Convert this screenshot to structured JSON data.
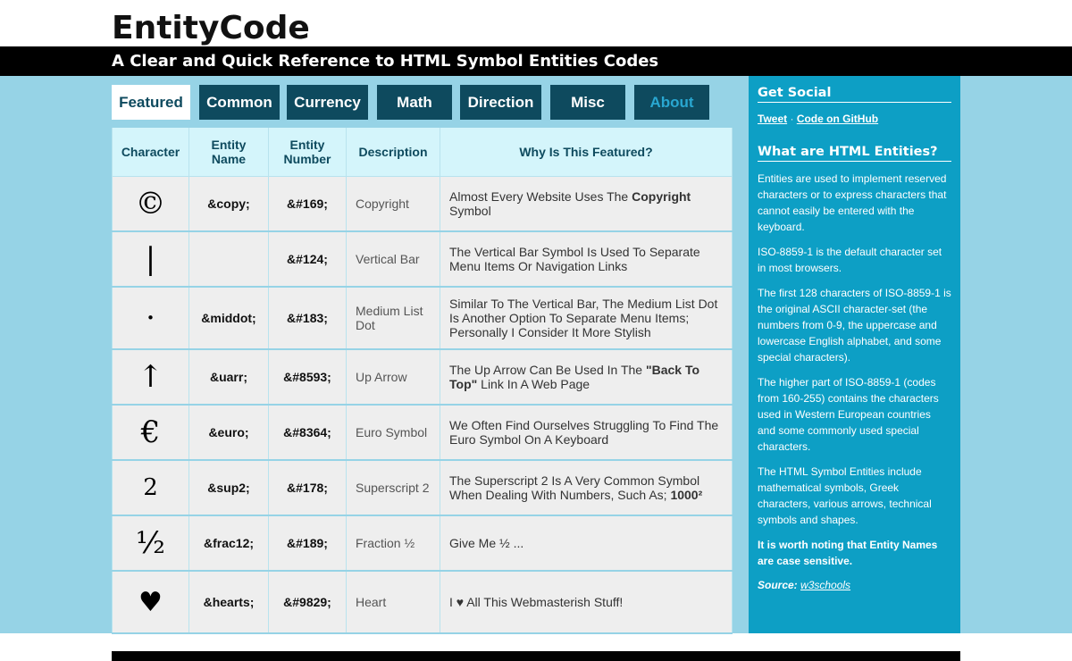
{
  "header": {
    "logo": "EntityCode",
    "tagline": "A Clear and Quick Reference to HTML Symbol Entities Codes"
  },
  "nav": {
    "tabs": [
      {
        "label": "Featured",
        "active": true
      },
      {
        "label": "Common"
      },
      {
        "label": "Currency"
      },
      {
        "label": "Math"
      },
      {
        "label": "Direction"
      },
      {
        "label": "Misc"
      },
      {
        "label": "About"
      }
    ]
  },
  "table": {
    "headers": [
      "Character",
      "Entity Name",
      "Entity Number",
      "Description",
      "Why Is This Featured?"
    ],
    "rows": [
      {
        "char": "©",
        "name": "&copy;",
        "number": "&#169;",
        "desc": "Copyright",
        "why_pre": "Almost Every Website Uses The ",
        "why_bold": "Copyright",
        "why_post": " Symbol"
      },
      {
        "char": "|",
        "name": "",
        "number": "&#124;",
        "desc": "Vertical Bar",
        "why_pre": "The Vertical Bar Symbol Is Used To Separate Menu Items Or Navigation Links",
        "why_bold": "",
        "why_post": ""
      },
      {
        "char": "·",
        "name": "&middot;",
        "number": "&#183;",
        "desc": "Medium List Dot",
        "why_pre": "Similar To The Vertical Bar, The Medium List Dot Is Another Option To Separate Menu Items; Personally I Consider It More Stylish",
        "why_bold": "",
        "why_post": ""
      },
      {
        "char": "↑",
        "name": "&uarr;",
        "number": "&#8593;",
        "desc": "Up Arrow",
        "why_pre": "The Up Arrow Can Be Used In The ",
        "why_bold": "\"Back To Top\"",
        "why_post": " Link In A Web Page"
      },
      {
        "char": "€",
        "name": "&euro;",
        "number": "&#8364;",
        "desc": "Euro Symbol",
        "why_pre": "We Often Find Ourselves Struggling To Find The Euro Symbol On A Keyboard",
        "why_bold": "",
        "why_post": ""
      },
      {
        "char": "2",
        "name": "&sup2;",
        "number": "&#178;",
        "desc": "Superscript 2",
        "why_pre": "The Superscript 2 Is A Very Common Symbol When Dealing With Numbers, Such As; ",
        "why_bold": "1000²",
        "why_post": ""
      },
      {
        "char": "½",
        "name": "&frac12;",
        "number": "&#189;",
        "desc": "Fraction ½",
        "why_pre": "Give Me ½ ...",
        "why_bold": "",
        "why_post": ""
      },
      {
        "char": "♥",
        "name": "&hearts;",
        "number": "&#9829;",
        "desc": "Heart",
        "why_pre": "I ♥ All This Webmasterish Stuff!",
        "why_bold": "",
        "why_post": ""
      }
    ]
  },
  "sidebar": {
    "social_heading": "Get Social",
    "tweet": "Tweet",
    "sep": "·",
    "github": "Code on GitHub",
    "entities_heading": "What are HTML Entities?",
    "p1": "Entities are used to implement reserved characters or to express characters that cannot easily be entered with the keyboard.",
    "p2": "ISO-8859-1 is the default character set in most browsers.",
    "p3": "The first 128 characters of ISO-8859-1 is the original ASCII character-set (the numbers from 0-9, the uppercase and lowercase English alphabet, and some special characters).",
    "p4": "The higher part of ISO-8859-1 (codes from 160-255) contains the characters used in Western European countries and some commonly used special characters.",
    "p5": "The HTML Symbol Entities include mathematical symbols, Greek characters, various arrows, technical symbols and shapes.",
    "p6": "It is worth noting that Entity Names are case sensitive.",
    "source_label": "Source:",
    "source_link": "w3schools"
  }
}
